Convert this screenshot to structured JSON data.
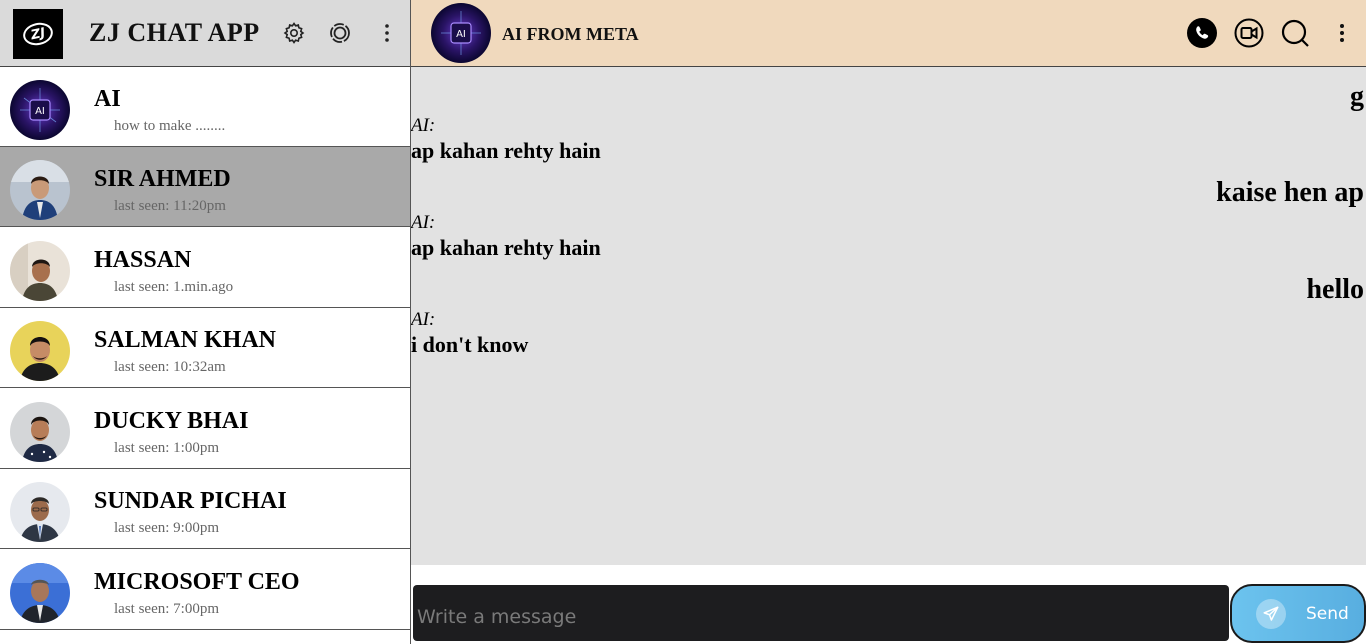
{
  "app": {
    "logo_text": "ZJ",
    "title": "ZJ CHAT APP",
    "header_icons": [
      "settings-icon",
      "status-icon",
      "more-vertical-icon"
    ]
  },
  "contacts": [
    {
      "name": "AI",
      "sub": "how to make ........",
      "active": false
    },
    {
      "name": "SIR AHMED",
      "sub": "last seen: 11:20pm",
      "active": true
    },
    {
      "name": "HASSAN",
      "sub": "last seen: 1.min.ago",
      "active": false
    },
    {
      "name": "SALMAN KHAN",
      "sub": "last seen: 10:32am",
      "active": false
    },
    {
      "name": "DUCKY BHAI",
      "sub": "last seen: 1:00pm",
      "active": false
    },
    {
      "name": "SUNDAR PICHAI",
      "sub": "last seen: 9:00pm",
      "active": false
    },
    {
      "name": "MICROSOFT CEO",
      "sub": "last seen: 7:00pm",
      "active": false
    }
  ],
  "chat": {
    "title": "AI FROM META",
    "avatar_label": "AI",
    "header_icons": [
      "phone-icon",
      "video-call-icon",
      "search-icon",
      "more-vertical-icon"
    ],
    "messages": [
      {
        "direction": "out",
        "text": "g"
      },
      {
        "direction": "in",
        "sender": "AI:",
        "text": "ap kahan rehty hain"
      },
      {
        "direction": "out",
        "text": "kaise hen ap"
      },
      {
        "direction": "in",
        "sender": "AI:",
        "text": "ap kahan rehty hain"
      },
      {
        "direction": "out",
        "text": "hello"
      },
      {
        "direction": "in",
        "sender": "AI:",
        "text": "i don't know"
      }
    ]
  },
  "composer": {
    "placeholder": "Write a message",
    "send_label": "Send"
  },
  "colors": {
    "chat_header_bg": "#f0d9bd",
    "messages_bg": "#e2e2e2",
    "active_contact_bg": "#a9a9a9",
    "send_button": "#6cc3ee"
  }
}
